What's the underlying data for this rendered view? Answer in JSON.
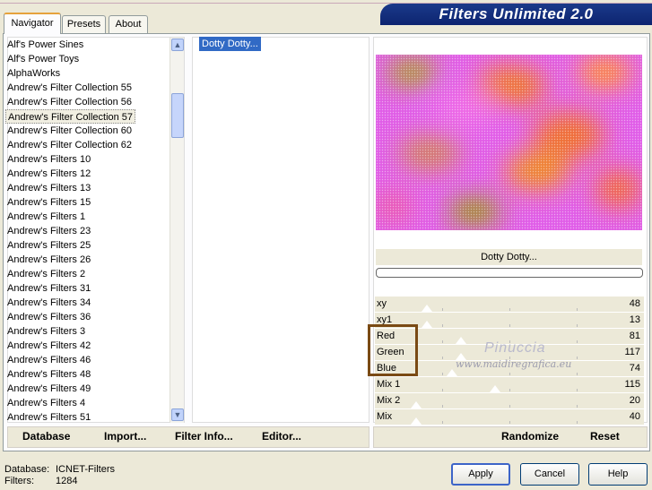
{
  "tabs": [
    {
      "label": "Navigator",
      "active": true
    },
    {
      "label": "Presets",
      "active": false
    },
    {
      "label": "About",
      "active": false
    }
  ],
  "banner_title": "Filters Unlimited 2.0",
  "categories": [
    "Alf's Power Sines",
    "Alf's Power Toys",
    "AlphaWorks",
    "Andrew's Filter Collection 55",
    "Andrew's Filter Collection 56",
    "Andrew's Filter Collection 57",
    "Andrew's Filter Collection 60",
    "Andrew's Filter Collection 62",
    "Andrew's Filters 10",
    "Andrew's Filters 12",
    "Andrew's Filters 13",
    "Andrew's Filters 15",
    "Andrew's Filters 1",
    "Andrew's Filters 23",
    "Andrew's Filters 25",
    "Andrew's Filters 26",
    "Andrew's Filters 2",
    "Andrew's Filters 31",
    "Andrew's Filters 34",
    "Andrew's Filters 36",
    "Andrew's Filters 3",
    "Andrew's Filters 42",
    "Andrew's Filters 46",
    "Andrew's Filters 48",
    "Andrew's Filters 49",
    "Andrew's Filters 4",
    "Andrew's Filters 51"
  ],
  "selected_category_index": 5,
  "filters": [
    "Dotty Dotty..."
  ],
  "preview_name": "Dotty Dotty...",
  "progress": 0,
  "params": [
    {
      "label": "xy",
      "value": "48"
    },
    {
      "label": "xy1",
      "value": "13"
    },
    {
      "label": "Red",
      "value": "81"
    },
    {
      "label": "Green",
      "value": "117"
    },
    {
      "label": "Blue",
      "value": "74"
    },
    {
      "label": "Mix 1",
      "value": "115"
    },
    {
      "label": "Mix 2",
      "value": "20"
    },
    {
      "label": "Mix",
      "value": "40"
    }
  ],
  "watermark": {
    "name": "Pinuccia",
    "url": "www.maidiregrafica.eu"
  },
  "toolbar_left": {
    "database": "Database",
    "import": "Import...",
    "filter_info": "Filter Info...",
    "editor": "Editor..."
  },
  "toolbar_right": {
    "randomize": "Randomize",
    "reset": "Reset"
  },
  "status": {
    "database_label": "Database:",
    "database_value": "ICNET-Filters",
    "filters_label": "Filters:",
    "filters_value": "1284"
  },
  "buttons": {
    "apply": "Apply",
    "cancel": "Cancel",
    "help": "Help"
  },
  "colors": {
    "accent": "#316ac5",
    "banner": "#1b3a8a",
    "highlight": "#7a4a14"
  }
}
